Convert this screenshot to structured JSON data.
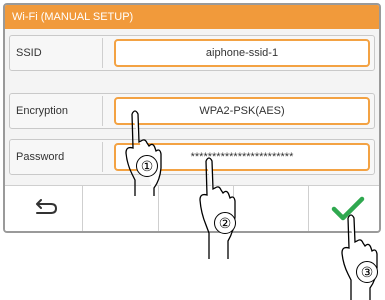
{
  "window": {
    "title": "Wi-Fi (MANUAL SETUP)"
  },
  "fields": [
    {
      "label": "SSID",
      "value": "aiphone-ssid-1"
    },
    {
      "label": "Encryption",
      "value": "WPA2-PSK(AES)"
    },
    {
      "label": "Password",
      "value": "************************"
    }
  ],
  "toolbar": {
    "back_icon": "back-arrow-icon",
    "confirm_icon": "checkmark-icon"
  },
  "callouts": [
    "①",
    "②",
    "③"
  ],
  "colors": {
    "accent": "#f19a3b",
    "field_border": "#f3a243",
    "confirm": "#2fa84f"
  }
}
